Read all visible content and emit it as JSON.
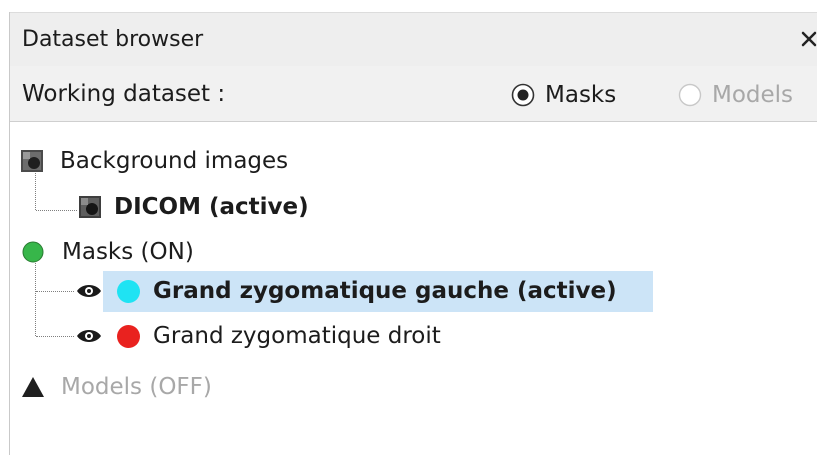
{
  "panel": {
    "title": "Dataset browser",
    "close_glyph": "✕"
  },
  "working_dataset": {
    "label": "Working dataset :",
    "options": [
      {
        "label": "Masks",
        "selected": true
      },
      {
        "label": "Models",
        "selected": false,
        "disabled": true
      }
    ]
  },
  "tree": {
    "background_images": {
      "label": "Background images",
      "icon": "image-icon",
      "children": [
        {
          "label": "DICOM (active)",
          "icon": "dicom-image-icon"
        }
      ]
    },
    "masks": {
      "label": "Masks (ON)",
      "status_color": "#37b64a",
      "children": [
        {
          "label": "Grand zygomatique gauche (active)",
          "color": "#1fe3f3",
          "visible_icon": "eye-icon",
          "selected": true
        },
        {
          "label": "Grand zygomatique droit",
          "color": "#e9221f",
          "visible_icon": "eye-icon",
          "selected": false
        }
      ]
    },
    "models": {
      "label": "Models (OFF)",
      "icon": "triangle-icon"
    }
  },
  "colors": {
    "selection": "#cce4f7",
    "titlebar": "#eeeeee",
    "disabled_text": "#a8a8a8"
  }
}
